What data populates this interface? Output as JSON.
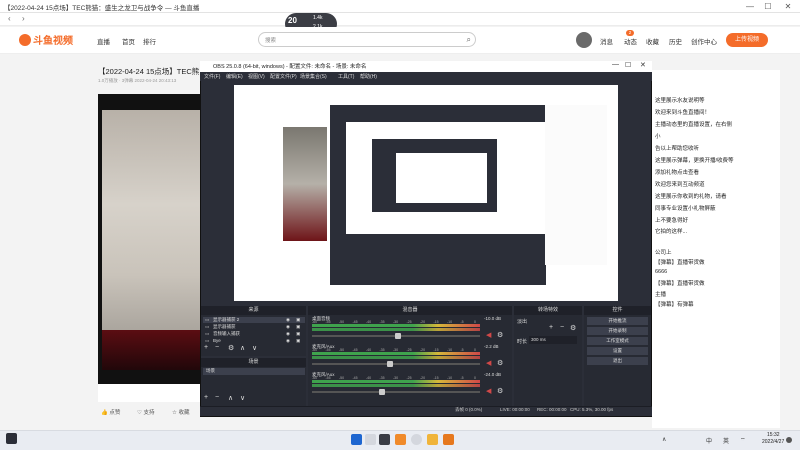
{
  "browser": {
    "tab_title": "【2022-04-24 15点场】TEC熊猫：盛生之龙卫与战争令 — 斗鱼直播",
    "controls": {
      "minimize": "—",
      "maximize": "☐",
      "close": "✕"
    }
  },
  "site": {
    "logo_text": "斗鱼 DOUYU",
    "nav": [
      "直播",
      "首页",
      "排行"
    ],
    "search_placeholder": "搜索",
    "header_links": [
      "消息",
      "动态",
      "收藏",
      "历史",
      "创作中心"
    ],
    "notification_count": "2",
    "upload_label": "上传视频"
  },
  "room": {
    "title": "【2022-04-24 15点场】TEC熊",
    "meta": "1.0万播放 · 3弹幕      2022-04-24 20:43:13",
    "likes": [
      "点赞",
      "支持",
      "收藏"
    ]
  },
  "volume_osd": {
    "level": "20",
    "up": "1.4k",
    "down": "2.1k"
  },
  "obs": {
    "title": "OBS 25.0.8 (64-bit, windows) - 配置文件: 未命名 - 场景: 未命名",
    "menu": [
      "文件(F)",
      "编辑(E)",
      "视图(V)",
      "配置文件(P)",
      "场景集合(S)",
      "工具(T)",
      "帮助(H)"
    ],
    "docks": {
      "sources": "来源",
      "scenes": "场景",
      "mixer": "混音器",
      "transitions": "转场特效",
      "controls": "控件"
    },
    "sources": [
      "显示器捕获 2",
      "显示器捕获",
      "音频输入捕获",
      "Bye"
    ],
    "mixer": [
      {
        "name": "桌面音频",
        "db": "-10.0 dB"
      },
      {
        "name": "麦克风/Aux",
        "db": "-2.2 dB"
      },
      {
        "name": "麦克风/Aux",
        "db": "-24.0 dB"
      }
    ],
    "scale_marks": [
      "-60",
      "-55",
      "-50",
      "-45",
      "-40",
      "-35",
      "-30",
      "-25",
      "-20",
      "-15",
      "-10",
      "-5",
      "0"
    ],
    "transition": {
      "type": "淡出",
      "duration_label": "时长",
      "duration": "300 ms"
    },
    "controls": [
      "开始推流",
      "开始录制",
      "工作室模式",
      "设置",
      "退出"
    ],
    "status": {
      "dropped": "丢帧 0 (0.0%)",
      "live": "LIVE: 00:00:00",
      "rec": "REC: 00:00:00",
      "cpu": "CPU: 5.3%, 30.00 fps"
    }
  },
  "chat": {
    "lines": [
      "这里展示水友说明等",
      "欢迎来到斗鱼直播间！",
      "主播动态里的直播设置，在右侧",
      "小",
      "告以上帮助您收听",
      "这里展示弹幕，更换开播/收费等",
      "添加礼物点击查看",
      "欢迎您来到互动频道",
      "这里展示你收到的礼物，请看",
      "同事专业设置小礼物屏蔽",
      "上不要急得好",
      "它拍的这样...",
      "",
      "公司上",
      "【弹幕】直播带货做",
      "6666",
      "【弹幕】直播带货做",
      "主播",
      "【弹幕】有弹幕"
    ]
  },
  "taskbar": {
    "tray": [
      "中",
      "英"
    ],
    "time": "15:32",
    "date": "2022/4/27"
  }
}
